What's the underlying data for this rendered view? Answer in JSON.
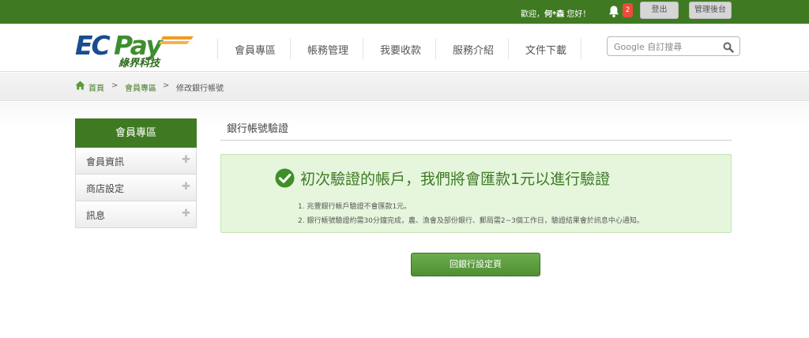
{
  "topbar": {
    "welcome_prefix": "歡迎，",
    "user": "何*森",
    "welcome_suffix": " 您好！",
    "notification_count": "2",
    "logout": "登出",
    "admin": "管理後台"
  },
  "logo": {
    "main": "ECPay",
    "sub": "綠界科技"
  },
  "nav": [
    "會員專區",
    "帳務管理",
    "我要收款",
    "服務介紹",
    "文件下載"
  ],
  "search": {
    "placeholder": "Google 自訂搜尋"
  },
  "breadcrumb": {
    "home": "首頁",
    "sep": ">",
    "member": "會員專區",
    "current": "修改銀行帳號"
  },
  "sidebar": {
    "title": "會員專區",
    "items": [
      {
        "label": "會員資訊"
      },
      {
        "label": "商店設定"
      },
      {
        "label": "訊息"
      }
    ]
  },
  "page_title": "銀行帳號驗證",
  "notice": {
    "heading": "初次驗證的帳戶，我們將會匯款1元以進行驗證",
    "items": [
      "1. 兆豐銀行帳戶驗證不會匯款1元。",
      "2. 銀行帳號驗證約需30分鐘完成，農、漁會及部份銀行、郵局需2~3個工作日，驗證結果會於訊息中心通知。"
    ]
  },
  "back_button": "回銀行設定頁",
  "colors": {
    "brand_green": "#3f7a23",
    "logo_blue": "#1a4d8f",
    "logo_orange": "#f39a1e",
    "notice_bg": "#e5f6dc"
  }
}
